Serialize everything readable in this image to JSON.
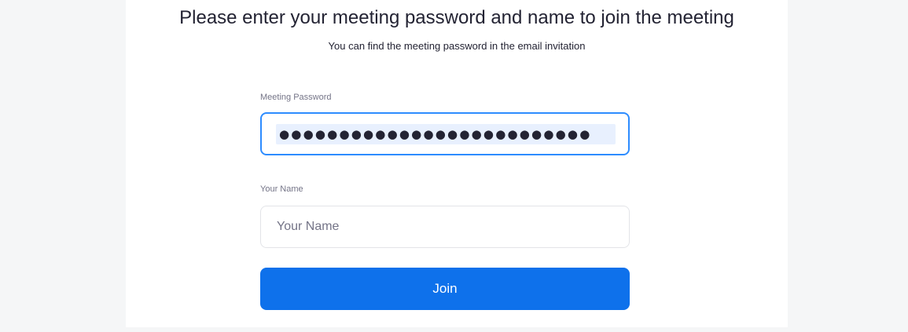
{
  "header": {
    "title": "Please enter your meeting password and name to join the meeting",
    "subtitle": "You can find the meeting password in the email invitation"
  },
  "form": {
    "password": {
      "label": "Meeting Password",
      "masked_value": "●●●●●●●●●●●●●●●●●●●●●●●●●●"
    },
    "name": {
      "label": "Your Name",
      "placeholder": "Your Name",
      "value": ""
    },
    "join_button_label": "Join"
  },
  "colors": {
    "accent": "#2d8cff",
    "button": "#0e71eb",
    "page_background": "#f5f6f7",
    "panel_background": "#ffffff"
  }
}
